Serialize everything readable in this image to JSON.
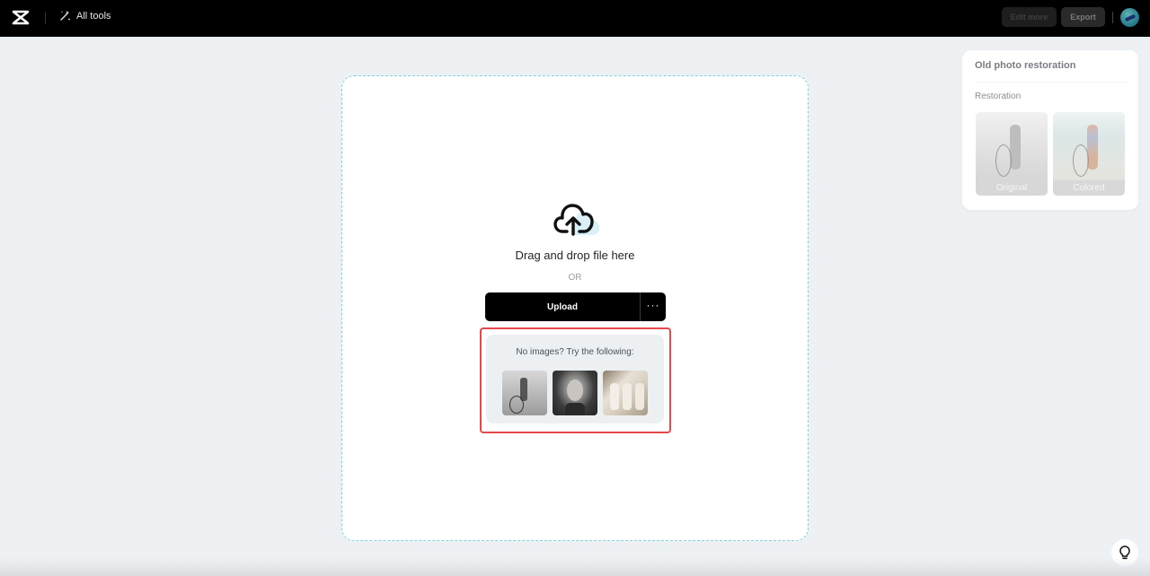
{
  "topbar": {
    "logo_icon": "capcut-logo-icon",
    "all_tools_icon": "magic-wand-icon",
    "all_tools_label": "All tools",
    "edit_more_label": "Edit more",
    "export_label": "Export",
    "avatar_icon": "user-avatar"
  },
  "dropzone": {
    "upload_icon": "cloud-upload-icon",
    "drag_text": "Drag and drop file here",
    "or_text": "OR",
    "upload_label": "Upload",
    "more_label": "···",
    "samples": {
      "title": "No images? Try the following:",
      "items": [
        {
          "name": "sample-girl-with-hoop"
        },
        {
          "name": "sample-girl-portrait"
        },
        {
          "name": "sample-group-women"
        }
      ],
      "highlight_color": "#e8484a"
    }
  },
  "panel": {
    "title": "Old photo restoration",
    "subtitle": "Restoration",
    "thumbs": [
      {
        "label": "Original"
      },
      {
        "label": "Colored"
      }
    ]
  },
  "help": {
    "icon": "lightbulb-icon"
  },
  "colors": {
    "accent_dash": "#7fd3df",
    "highlight": "#e8484a",
    "topbar_bg": "#000000",
    "page_bg": "#eef1f4"
  }
}
